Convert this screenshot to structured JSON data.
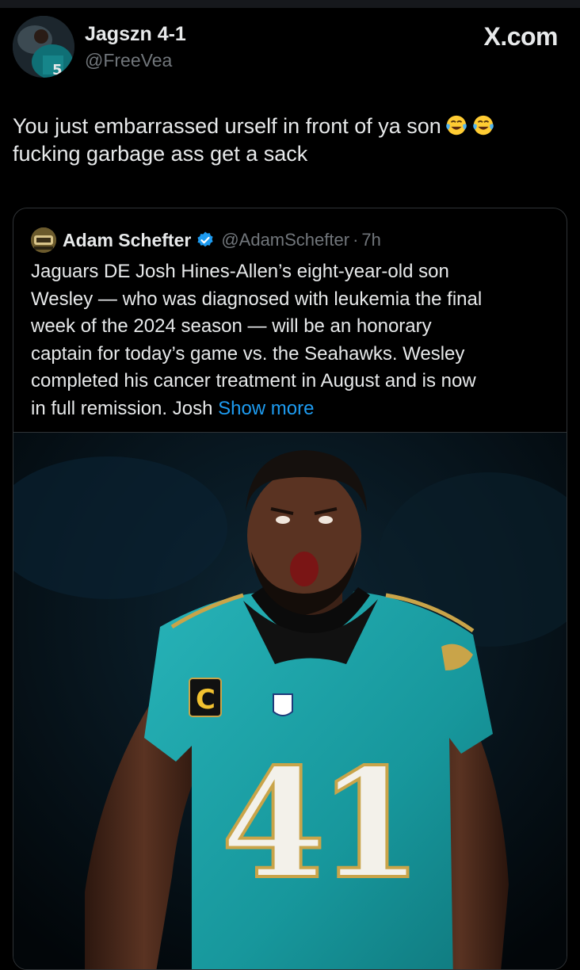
{
  "tweet": {
    "author_name": "Jagszn 4-1",
    "author_handle": "@FreeVea",
    "site_label": "X.com",
    "text_lines": [
      "You just embarrassed urself in front of ya son",
      "fucking garbage ass get a sack"
    ],
    "emoji": [
      "face-with-tears-of-joy",
      "face-with-tears-of-joy"
    ]
  },
  "quote": {
    "author_name": "Adam Schefter",
    "author_handle": "@AdamSchefter",
    "separator": "·",
    "time": "7h",
    "verified": true,
    "text_lines": [
      "Jaguars DE Josh Hines-Allen’s eight-year-old son",
      "Wesley — who was diagnosed with leukemia the final",
      "week of the 2024 season — will be an honorary",
      "captain for today’s game vs. the Seahawks. Wesley",
      "completed his cancer treatment in August and is now",
      "in full remission. Josh"
    ],
    "show_more_label": "Show more",
    "media": {
      "description_icon": "football-player-photo",
      "jersey_number": "41",
      "captain_patch": "C",
      "colors": {
        "jersey": "#1ba0a6",
        "skin": "#4a2a1c",
        "background": "#071219"
      }
    }
  },
  "colors": {
    "background": "#000000",
    "text": "#e7e9ea",
    "secondary_text": "#71767b",
    "link": "#1d9bf0",
    "border": "#2f3336"
  }
}
